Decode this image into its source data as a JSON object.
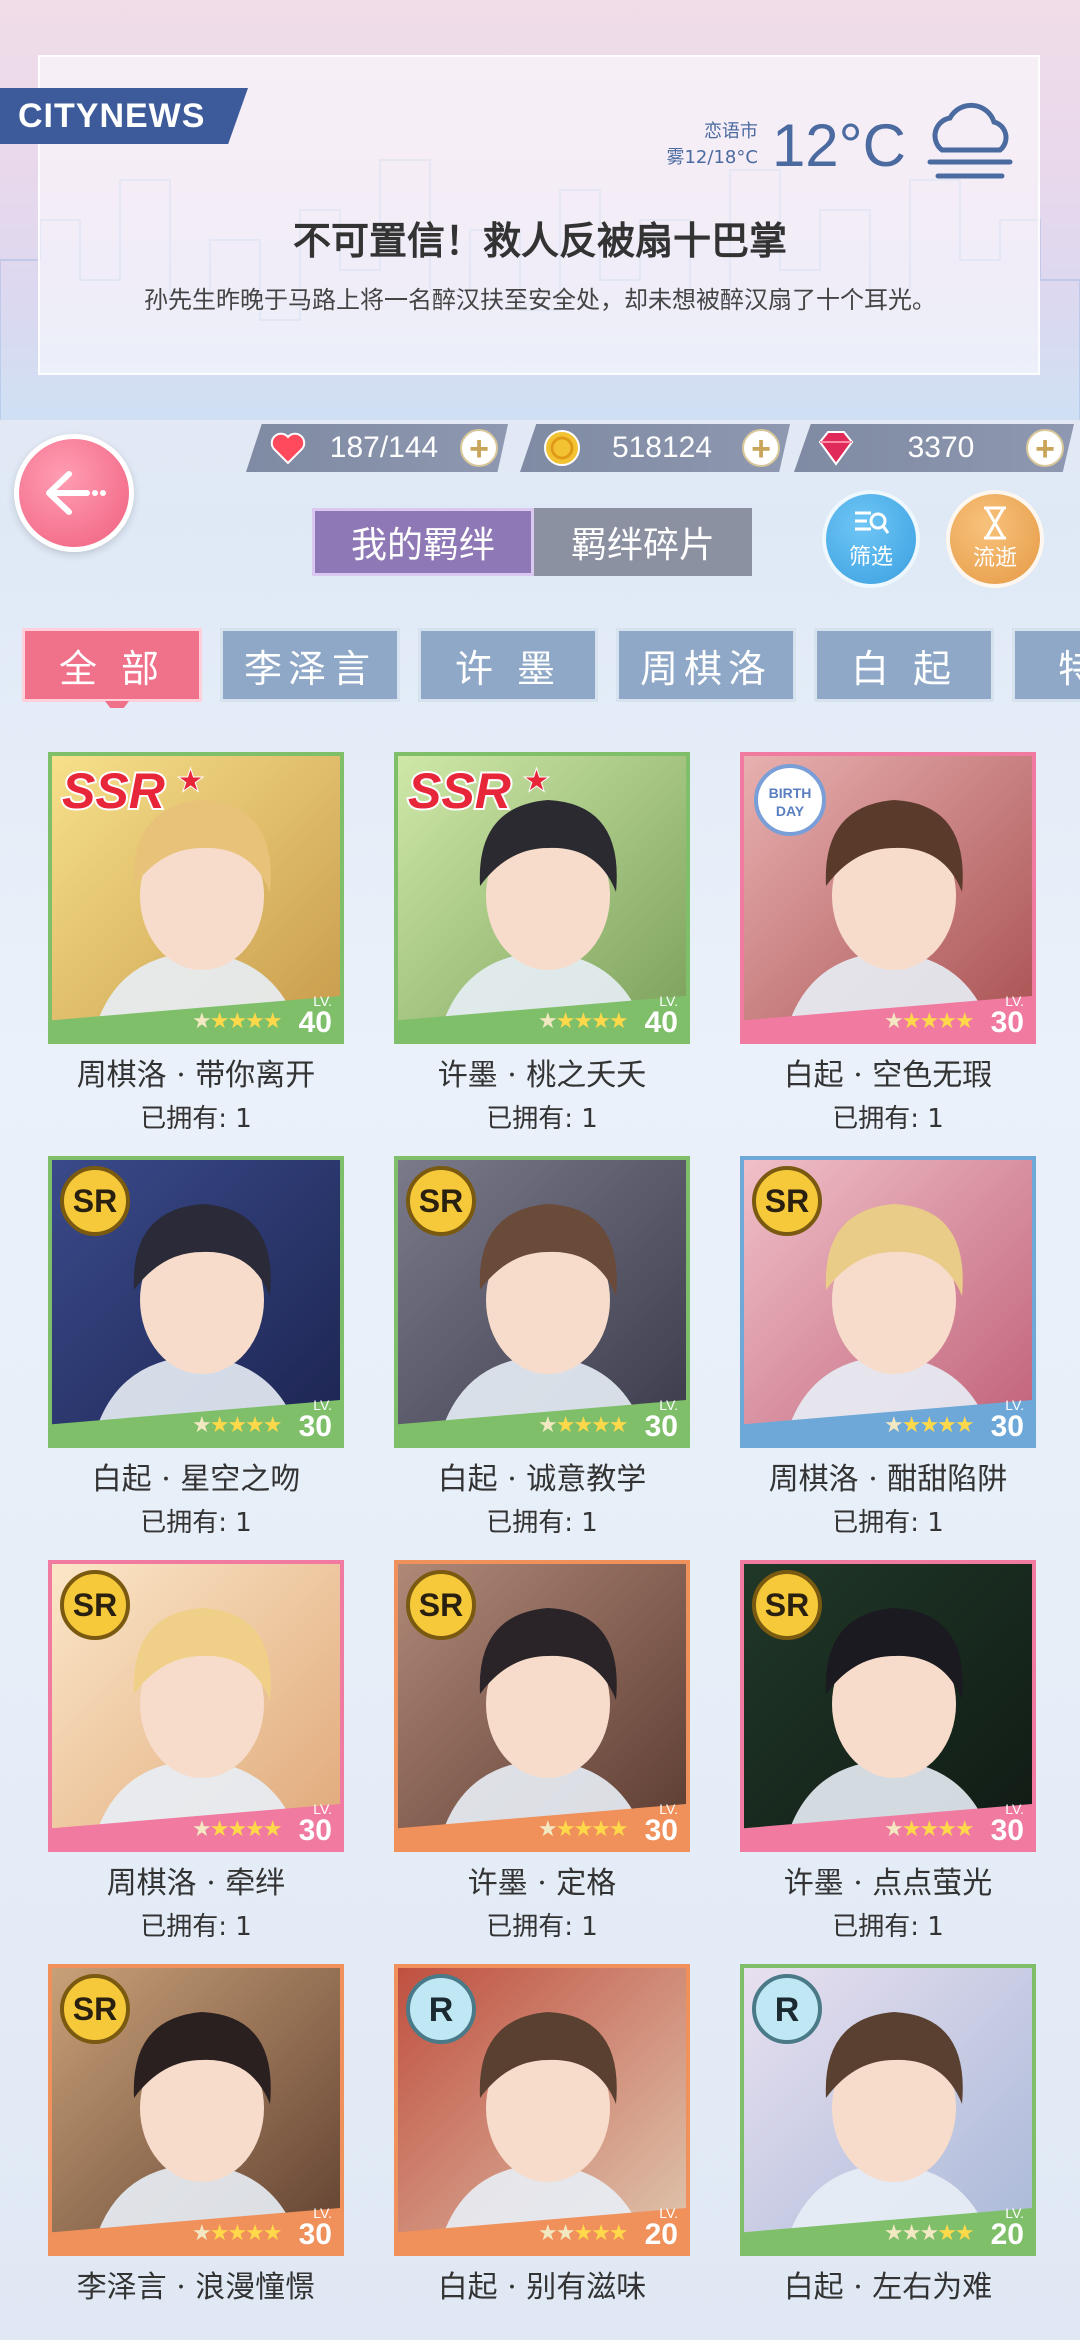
{
  "news": {
    "tag": "CITYNEWS",
    "city": "恋语市",
    "weather_detail": "雾12/18°C",
    "temperature": "12°C",
    "weather_icon": "fog-cloud-icon",
    "headline": "不可置信！救人反被扇十巴掌",
    "subline": "孙先生昨晚于马路上将一名醉汉扶至安全处，却未想被醉汉扇了十个耳光。"
  },
  "resources": {
    "stamina": "187/144",
    "gold": "518124",
    "diamonds": "3370"
  },
  "segment": {
    "active": "我的羁绊",
    "other": "羁绊碎片"
  },
  "buttons": {
    "filter": "筛选",
    "flow": "流逝"
  },
  "tabs": [
    "全 部",
    "李泽言",
    "许 墨",
    "周棋洛",
    "白 起",
    "特别"
  ],
  "cards": [
    {
      "name": "周棋洛 · 带你离开",
      "owned": "已拥有: 1",
      "rarity": "SSR",
      "level": "40",
      "stars": 4,
      "color": "#7fbf6a"
    },
    {
      "name": "许墨 · 桃之夭夭",
      "owned": "已拥有: 1",
      "rarity": "SSR",
      "level": "40",
      "stars": 4,
      "color": "#7fbf6a"
    },
    {
      "name": "白起 · 空色无瑕",
      "owned": "已拥有: 1",
      "rarity": "BIRTHDAY",
      "level": "30",
      "stars": 4,
      "color": "#f07aa0"
    },
    {
      "name": "白起 · 星空之吻",
      "owned": "已拥有: 1",
      "rarity": "SR",
      "level": "30",
      "stars": 4,
      "color": "#7fbf6a"
    },
    {
      "name": "白起 · 诚意教学",
      "owned": "已拥有: 1",
      "rarity": "SR",
      "level": "30",
      "stars": 4,
      "color": "#7fbf6a"
    },
    {
      "name": "周棋洛 · 酣甜陷阱",
      "owned": "已拥有: 1",
      "rarity": "SR",
      "level": "30",
      "stars": 4,
      "color": "#6ea8d8"
    },
    {
      "name": "周棋洛 · 牵绊",
      "owned": "已拥有: 1",
      "rarity": "SR",
      "level": "30",
      "stars": 4,
      "color": "#f07aa0"
    },
    {
      "name": "许墨 · 定格",
      "owned": "已拥有: 1",
      "rarity": "SR",
      "level": "30",
      "stars": 4,
      "color": "#f0905a"
    },
    {
      "name": "许墨 · 点点萤光",
      "owned": "已拥有: 1",
      "rarity": "SR",
      "level": "30",
      "stars": 4,
      "color": "#f07aa0"
    },
    {
      "name": "李泽言 · 浪漫憧憬",
      "owned": "",
      "rarity": "SR",
      "level": "30",
      "stars": 4,
      "color": "#f0905a"
    },
    {
      "name": "白起 · 别有滋味",
      "owned": "",
      "rarity": "R",
      "level": "20",
      "stars": 3,
      "color": "#f0905a"
    },
    {
      "name": "白起 · 左右为难",
      "owned": "",
      "rarity": "R",
      "level": "20",
      "stars": 2,
      "color": "#7fbf6a"
    }
  ]
}
